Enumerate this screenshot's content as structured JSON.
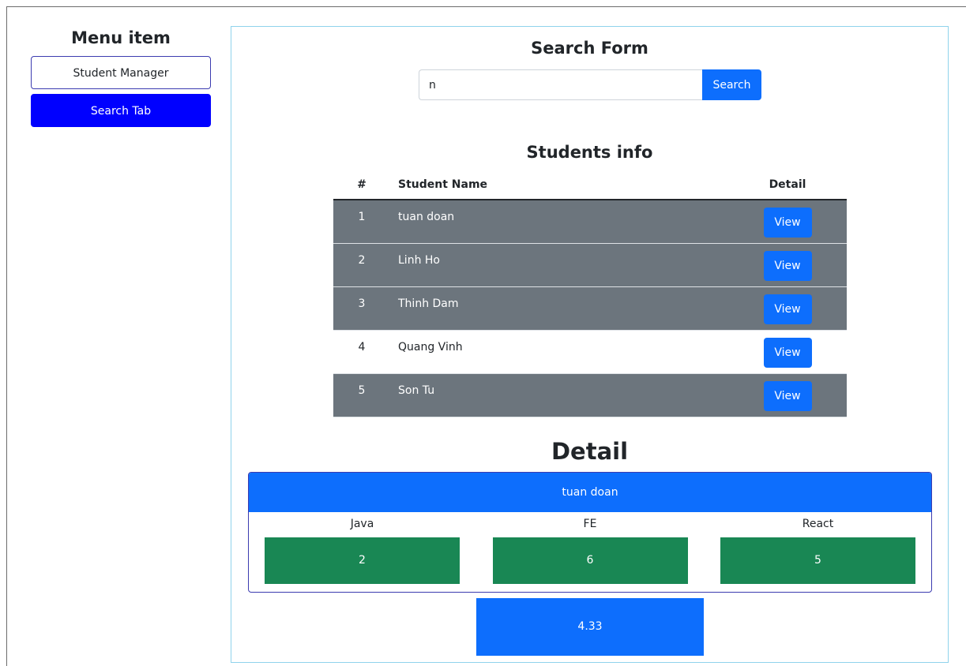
{
  "sidebar": {
    "title": "Menu item",
    "items": [
      {
        "label": "Student Manager",
        "style": "outline"
      },
      {
        "label": "Search Tab",
        "style": "solid"
      }
    ]
  },
  "search": {
    "title": "Search Form",
    "value": "n",
    "button_label": "Search"
  },
  "students": {
    "title": "Students info",
    "columns": [
      "#",
      "Student Name",
      "Detail"
    ],
    "rows": [
      {
        "num": "1",
        "name": "tuan doan",
        "action": "View"
      },
      {
        "num": "2",
        "name": "Linh Ho",
        "action": "View"
      },
      {
        "num": "3",
        "name": "Thinh Dam",
        "action": "View"
      },
      {
        "num": "4",
        "name": "Quang Vinh",
        "action": "View"
      },
      {
        "num": "5",
        "name": "Son Tu",
        "action": "View"
      }
    ]
  },
  "detail": {
    "title": "Detail",
    "student_name": "tuan doan",
    "subjects": [
      {
        "name": "Java",
        "score": "2"
      },
      {
        "name": "FE",
        "score": "6"
      },
      {
        "name": "React",
        "score": "5"
      }
    ],
    "average": "4.33"
  },
  "colors": {
    "primary": "#0d6efd",
    "sidebar_active": "#0000ff",
    "row_dark": "#6c757d",
    "score_green": "#198754",
    "panel_border": "#8fd3ec"
  }
}
